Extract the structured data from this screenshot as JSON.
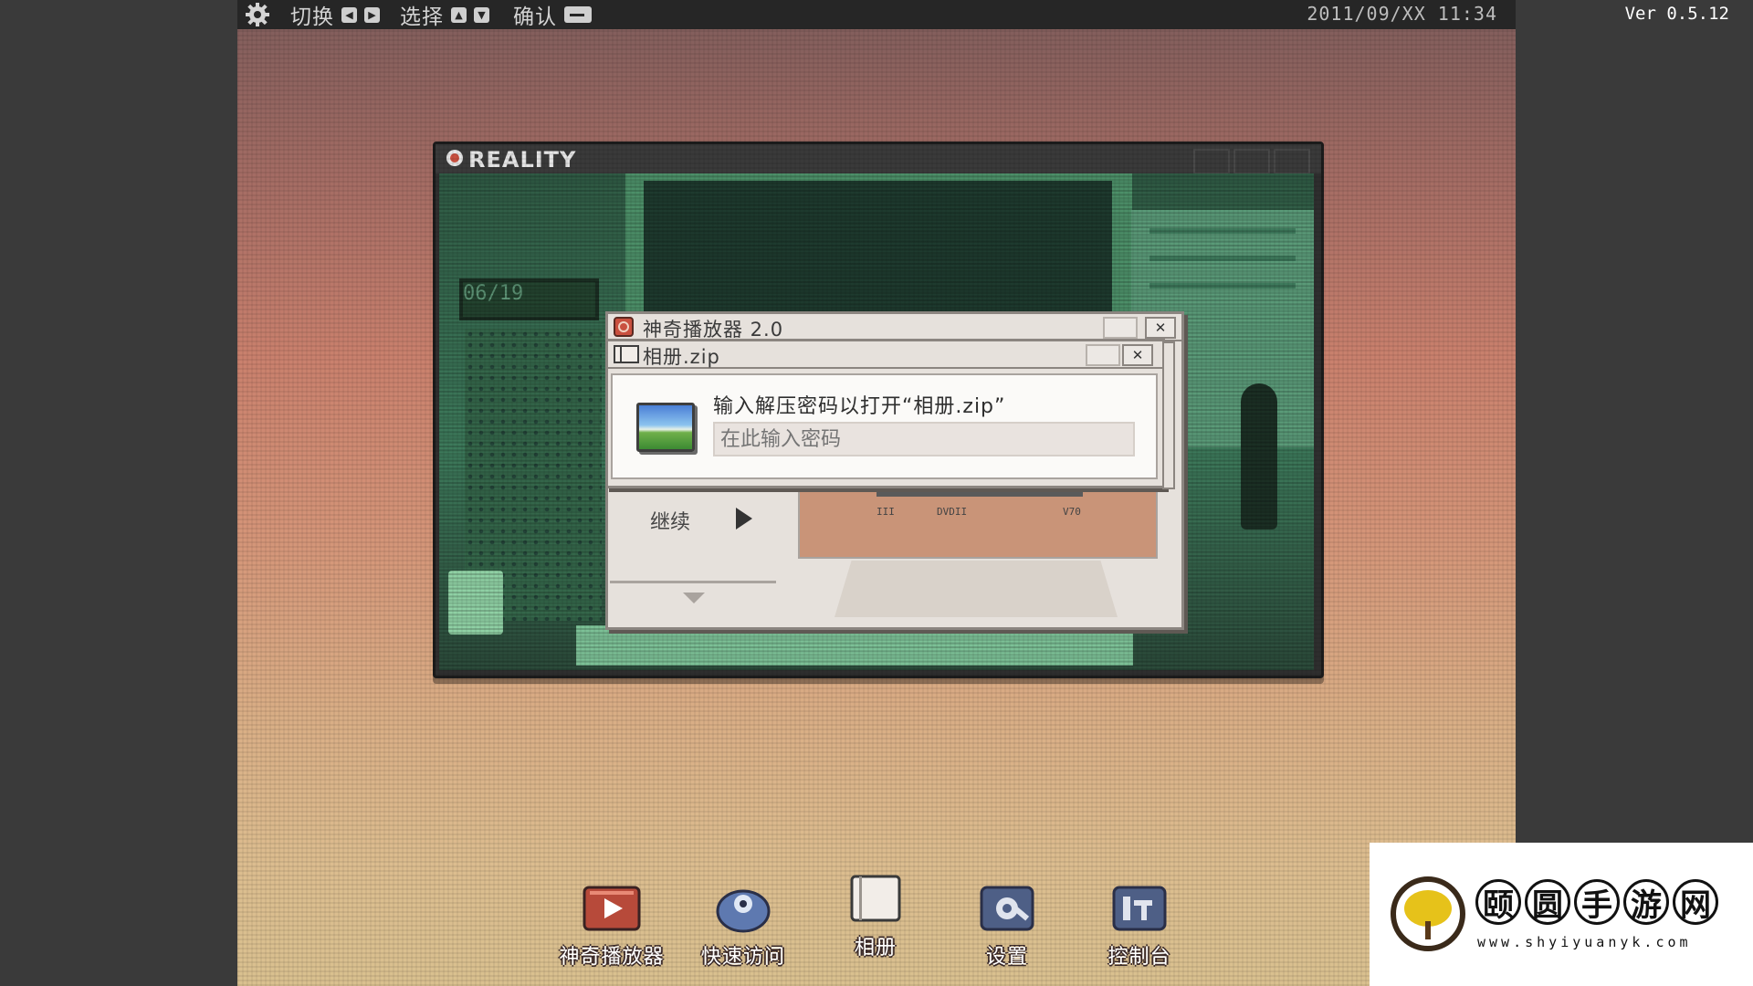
{
  "topbar": {
    "switch_label": "切换",
    "select_label": "选择",
    "confirm_label": "确认",
    "datetime": "2011/09/XX  11:34",
    "version": "Ver 0.5.12"
  },
  "reality_window": {
    "title": "REALITY",
    "clock_text": "06/19"
  },
  "player_window": {
    "title": "神奇播放器 2.0",
    "close_glyph": "✕",
    "continue_label": "继续",
    "cassette_labels": [
      "III",
      "DVDII",
      "V70"
    ]
  },
  "zip_window": {
    "title": "相册.zip",
    "close_glyph": "✕",
    "prompt": "输入解压密码以打开“相册.zip”",
    "password_placeholder": "在此输入密码"
  },
  "dock": {
    "items": [
      {
        "label": "神奇播放器",
        "icon": "player-icon"
      },
      {
        "label": "快速访问",
        "icon": "quick-access-icon"
      },
      {
        "label": "相册",
        "icon": "album-icon"
      },
      {
        "label": "设置",
        "icon": "settings-icon"
      },
      {
        "label": "控制台",
        "icon": "console-icon"
      }
    ]
  },
  "watermark": {
    "chars": [
      "颐",
      "圆",
      "手",
      "游",
      "网"
    ],
    "url": "www.shyiyuanyk.com"
  },
  "colors": {
    "bar": "#262626",
    "accent_red": "#c9503f",
    "scene_green": "#3d7a5b",
    "dialog_bg": "#e6e1dc"
  }
}
